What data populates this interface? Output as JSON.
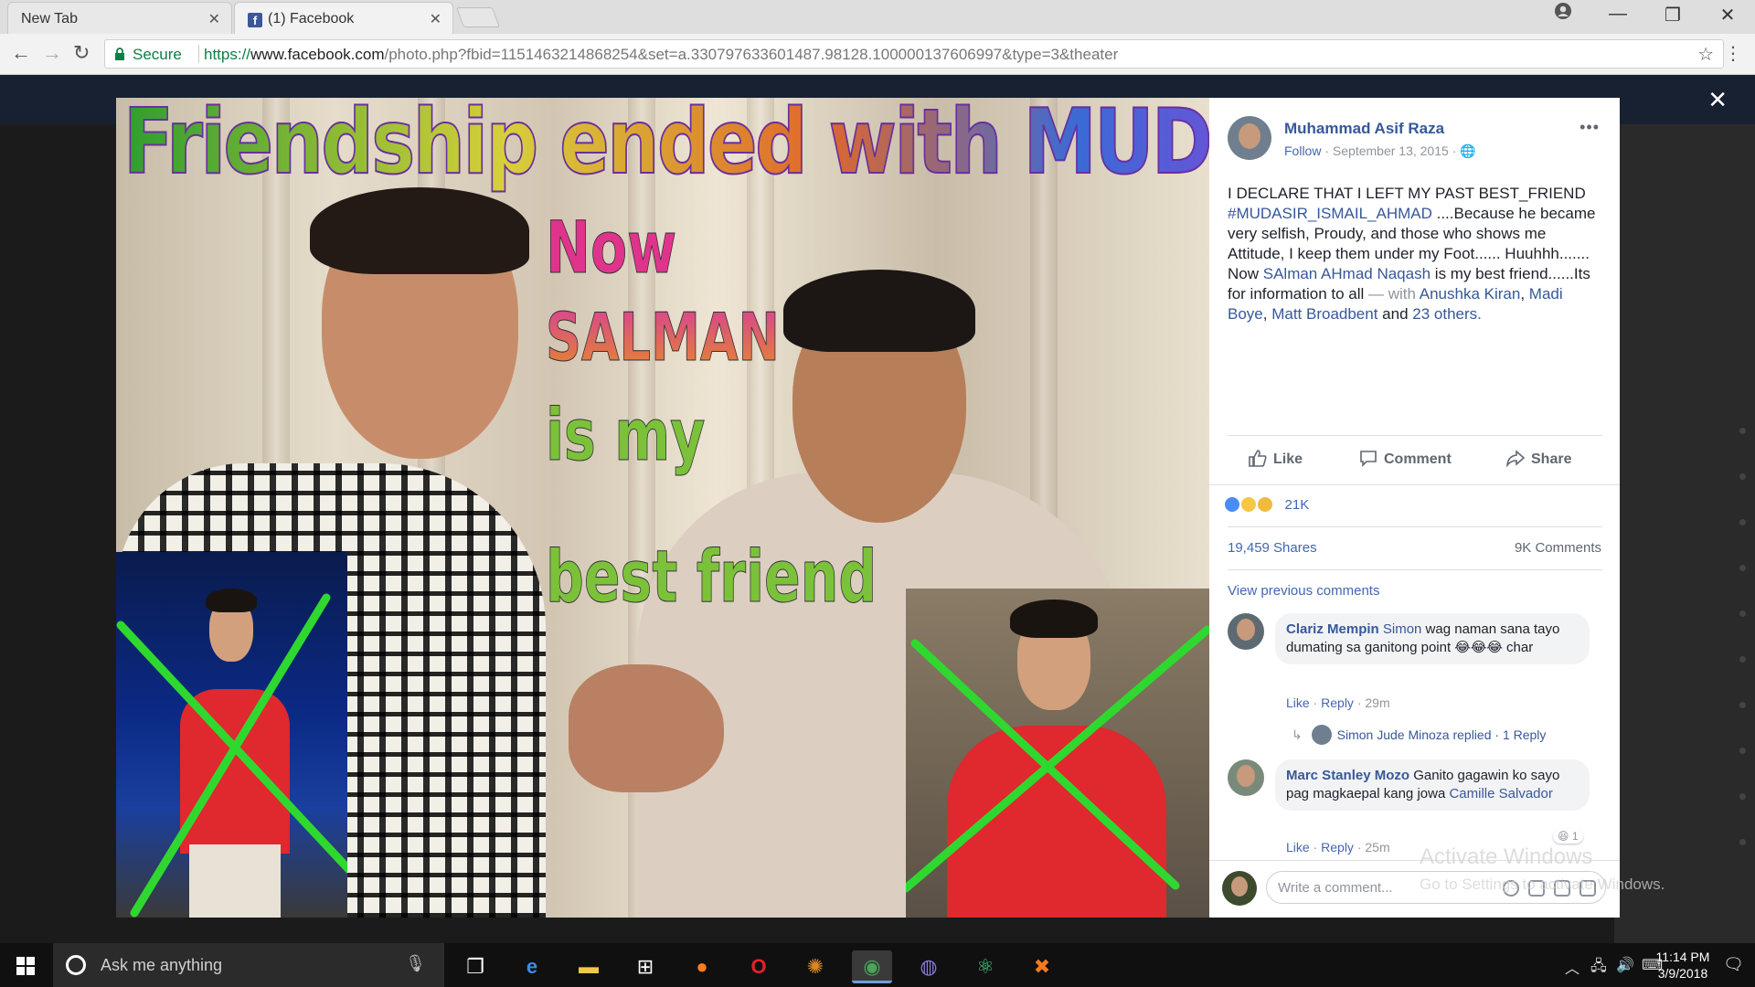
{
  "browser": {
    "tabs": [
      {
        "label": "New Tab"
      },
      {
        "label": "(1) Facebook"
      }
    ],
    "secure_label": "Secure",
    "url_scheme": "https://",
    "url_host": "www.facebook.com",
    "url_rest": "/photo.php?fbid=1151463214868254&set=a.330797633601487.98128.100000137606997&type=3&theater"
  },
  "photo": {
    "title": "Friendship ended with MUDASIR",
    "now_lines": [
      "Now",
      "SALMAN",
      "is my",
      "best friend"
    ]
  },
  "post": {
    "author": "Muhammad Asif Raza",
    "follow": "Follow",
    "date": "September 13, 2015",
    "more": "•••",
    "text_1": "I DECLARE THAT I LEFT MY PAST BEST_FRIEND",
    "hashtag": "#MUDASIR_ISMAIL_AHMAD",
    "text_2": " ....Because he became very selfish, Proudy, and those who shows me Attitude, I keep them under my Foot...... Huuhhh.......",
    "text_3": "Now ",
    "mention_1": "SAlman AHmad Naqash",
    "text_4": " is my best friend......Its for information to all",
    "with_label": " — with ",
    "tag_1": "Anushka Kiran",
    "tag_2": "Madi Boye",
    "tag_3": "Matt Broadbent",
    "and_label": " and ",
    "tag_others": "23 others."
  },
  "actions": {
    "like": "Like",
    "comment": "Comment",
    "share": "Share"
  },
  "stats": {
    "reactions": "21K",
    "shares": "19,459 Shares",
    "comments": "9K Comments",
    "view_previous": "View previous comments"
  },
  "comments": [
    {
      "author": "Clariz Mempin",
      "mention": "Simon",
      "text": " wag naman sana tayo dumating sa ganitong point 😂😂😂 char",
      "like": "Like",
      "reply": "Reply",
      "time": "29m",
      "reply_thread": "Simon Jude Minoza replied",
      "reply_count": "1 Reply"
    },
    {
      "author": "Marc Stanley Mozo",
      "text": " Ganito gagawin ko sayo pag magkaepal kang jowa ",
      "mention": "Camille Salvador",
      "like": "Like",
      "reply": "Reply",
      "time": "25m",
      "reaction_count": "1"
    }
  ],
  "write_comment_placeholder": "Write a comment...",
  "watermark": {
    "line1": "Activate Windows",
    "line2": "Go to Settings to activate Windows."
  },
  "taskbar": {
    "search_placeholder": "Ask me anything",
    "time": "11:14 PM",
    "date": "3/9/2018"
  },
  "colors": {
    "facebook_blue": "#365899",
    "accent_green": "#2fd82f",
    "meme_pink": "#e0338c"
  }
}
